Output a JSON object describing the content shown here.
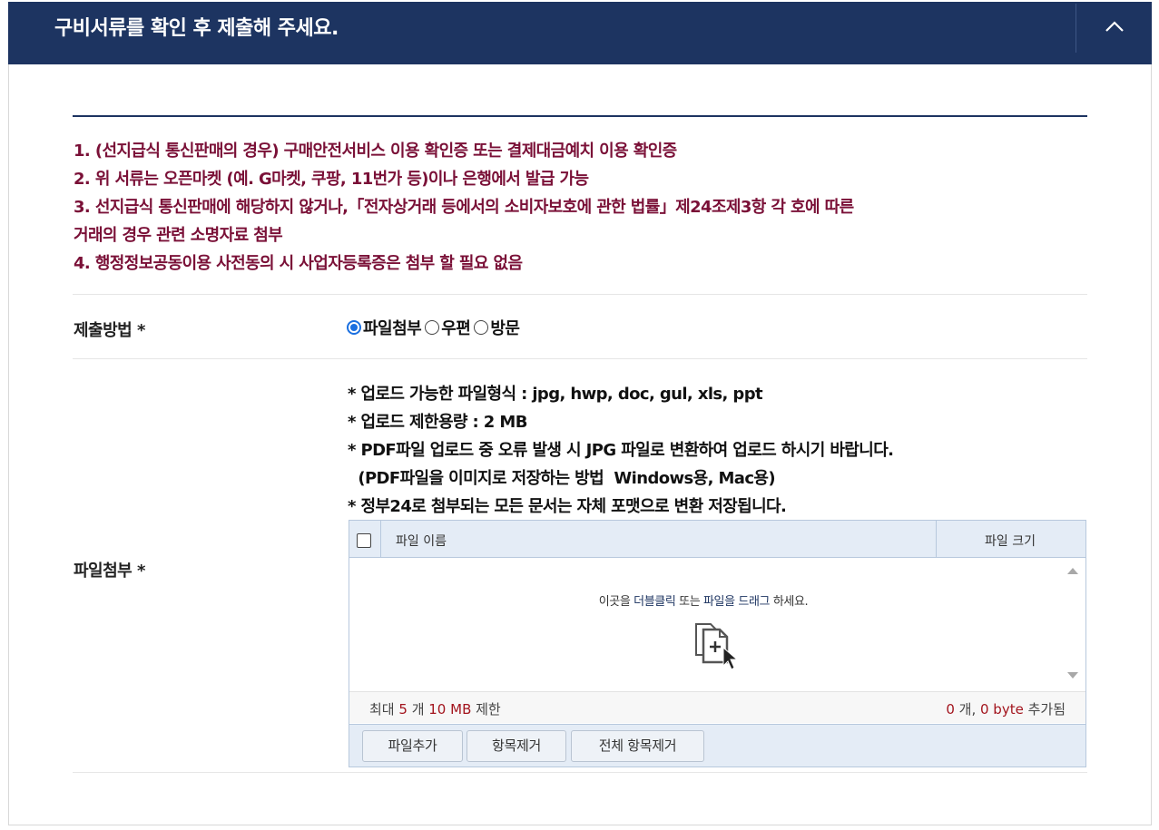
{
  "header": {
    "title": "구비서류를 확인 후 제출해 주세요.",
    "collapse_icon": "chevron-up-icon"
  },
  "notice": {
    "lines": [
      "1. (선지급식 통신판매의 경우) 구매안전서비스 이용 확인증 또는 결제대금예치 이용 확인증",
      "2. 위 서류는 오픈마켓 (예. G마켓, 쿠팡, 11번가 등)이나 은행에서 발급 가능",
      "3. 선지급식 통신판매에 해당하지 않거나,「전자상거래 등에서의 소비자보호에 관한 법률」제24조제3항 각 호에 따른",
      "거래의 경우 관련 소명자료 첨부",
      "4. 행정정보공동이용 사전동의 시 사업자등록증은 첨부 할 필요 없음"
    ],
    "color": "#7a1037"
  },
  "submit_method": {
    "label": "제출방법 *",
    "options": [
      "파일첨부",
      "우편",
      "방문"
    ],
    "selected": "파일첨부"
  },
  "attachment": {
    "label": "파일첨부 *",
    "guide": [
      "* 업로드 가능한 파일형식 : jpg, hwp, doc, gul, xls, ppt",
      "* 업로드 제한용량 : 2 MB",
      "* PDF파일 업로드 중 오류 발생 시 JPG 파일로 변환하여 업로드 하시기 바랍니다.",
      "  (PDF파일을 이미지로 저장하는 방법  Windows용, Mac용)",
      "* 정부24로 첨부되는 모든 문서는 자체 포맷으로 변환 저장됩니다."
    ]
  },
  "uploader": {
    "col_name": "파일 이름",
    "col_size": "파일 크기",
    "drop": {
      "pre": "이곳을 ",
      "link1": "더블클릭",
      "mid": " 또는 ",
      "link2": "파일을 드래그",
      "post": " 하세요."
    },
    "status": {
      "max_prefix": "최대 ",
      "max_count": "5",
      "max_mid": " 개 ",
      "max_size": "10 MB",
      "max_suffix": " 제한",
      "added_count": "0",
      "added_mid": " 개, ",
      "added_bytes": "0 byte",
      "added_suffix": " 추가됨"
    },
    "buttons": {
      "add": "파일추가",
      "remove": "항목제거",
      "remove_all": "전체 항목제거"
    }
  },
  "colors": {
    "header_bg": "#1d3461",
    "accent_red": "#a3151e",
    "radio_blue": "#1a6fe0"
  }
}
